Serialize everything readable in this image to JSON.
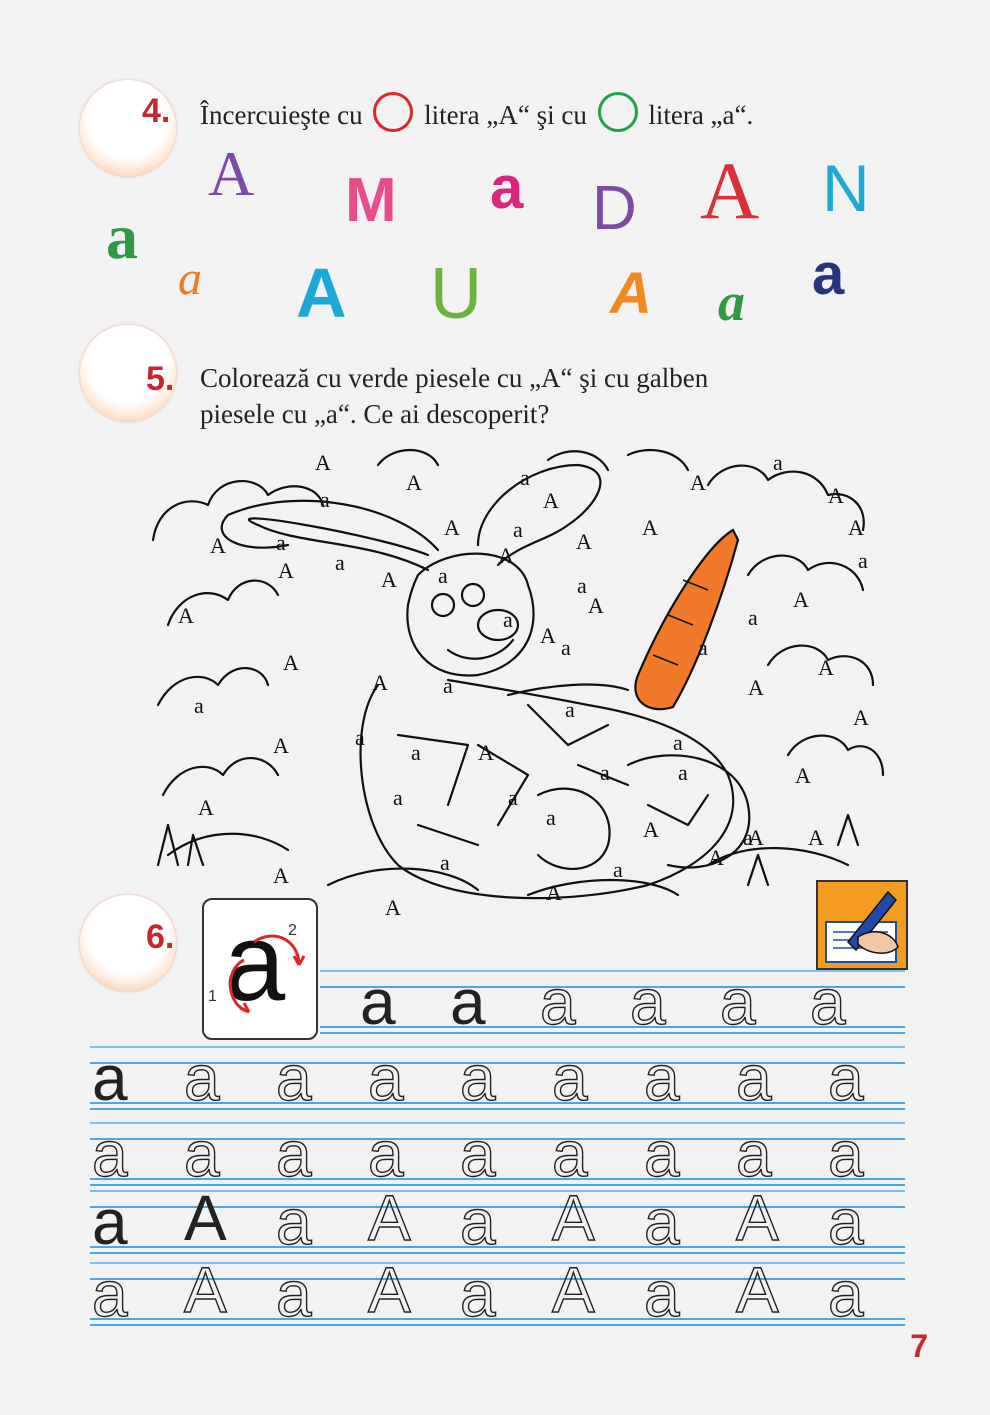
{
  "exercise4": {
    "number": "4.",
    "text_part1": "Încercuieşte cu",
    "text_part2": "litera „A“ şi cu",
    "text_part3": "litera „a“.",
    "ring_colors": [
      "#e0252b",
      "#23a04a"
    ],
    "letters": [
      {
        "char": "A",
        "color": "#7d4aa6"
      },
      {
        "char": "M",
        "color": "#e84c8b"
      },
      {
        "char": "a",
        "color": "#d9257b"
      },
      {
        "char": "D",
        "color": "#7d4aa6"
      },
      {
        "char": "A",
        "color": "#d9303a"
      },
      {
        "char": "N",
        "color": "#1ea8d8"
      },
      {
        "char": "a",
        "color": "#2e9a43"
      },
      {
        "char": "a",
        "color": "#ee7a22"
      },
      {
        "char": "A",
        "color": "#1ea8d8"
      },
      {
        "char": "U",
        "color": "#6db33f"
      },
      {
        "char": "A",
        "color": "#f08a1f"
      },
      {
        "char": "a",
        "color": "#2e9a43"
      },
      {
        "char": "a",
        "color": "#26357e"
      }
    ]
  },
  "exercise5": {
    "number": "5.",
    "line1": "Colorează cu verde piesele cu „A“ şi cu galben",
    "line2": "piesele cu „a“. Ce ai descoperit?",
    "picture_letters": [
      "A",
      "a",
      "A",
      "a",
      "A",
      "A",
      "a",
      "A",
      "A",
      "a",
      "A",
      "a",
      "A",
      "A",
      "a",
      "A",
      "a",
      "A",
      "A",
      "a",
      "A",
      "A",
      "a",
      "A",
      "a",
      "A",
      "a",
      "A",
      "a",
      "A",
      "A",
      "a",
      "A",
      "a",
      "a",
      "A",
      "a",
      "A",
      "a",
      "A",
      "a",
      "a",
      "A",
      "a",
      "a",
      "A",
      "a",
      "A",
      "a",
      "a",
      "A",
      "a",
      "A",
      "a",
      "A",
      "A",
      "A",
      "a",
      "A",
      "A"
    ],
    "carrot_color": "#f07a2a"
  },
  "exercise6": {
    "number": "6.",
    "model_letter": "a",
    "stroke_order": [
      "1",
      "2"
    ],
    "row1": [
      "a",
      "a",
      "a",
      "a",
      "a",
      "a"
    ],
    "row2": [
      "a",
      "a",
      "a",
      "a",
      "a",
      "a",
      "a",
      "a",
      "a"
    ],
    "row3": [
      "a",
      "a",
      "a",
      "a",
      "a",
      "a",
      "a",
      "a",
      "a"
    ],
    "row4": [
      "a",
      "A",
      "a",
      "A",
      "a",
      "A",
      "a",
      "A",
      "a"
    ],
    "row5": [
      "a",
      "A",
      "a",
      "A",
      "a",
      "A",
      "a",
      "A",
      "a"
    ]
  },
  "page_number": "7"
}
